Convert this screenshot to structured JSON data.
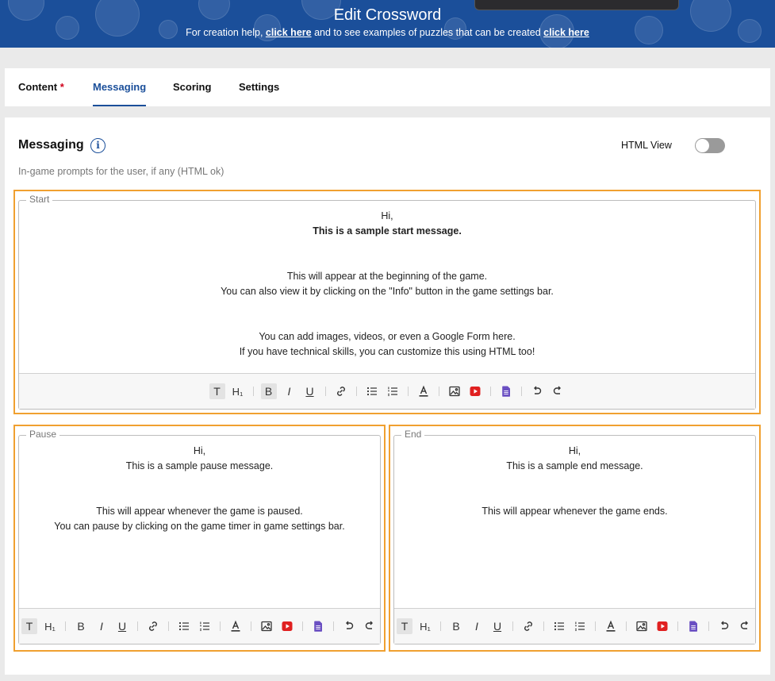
{
  "header": {
    "title": "Edit Crossword",
    "help_prefix": "For creation help, ",
    "help_link1": "click here",
    "help_middle": " and to see examples of puzzles that can be created ",
    "help_link2": "click here"
  },
  "tabs": [
    {
      "label": "Content",
      "required_mark": "*"
    },
    {
      "label": "Messaging"
    },
    {
      "label": "Scoring"
    },
    {
      "label": "Settings"
    }
  ],
  "panel": {
    "title": "Messaging",
    "info_icon_glyph": "i",
    "html_view_label": "HTML View",
    "html_view_enabled": false,
    "subtitle": "In-game prompts for the user, if any (HTML ok)"
  },
  "editors": {
    "start": {
      "legend": "Start",
      "lines": [
        "Hi,",
        "This is a sample start message.",
        "",
        "",
        "This will appear at the beginning of the game.",
        "You can also view it by clicking on the \"Info\" button in the game settings bar.",
        "",
        "",
        "You can add images, videos, or even a Google Form here.",
        "If you have technical skills, you can customize this using HTML too!"
      ]
    },
    "pause": {
      "legend": "Pause",
      "lines": [
        "Hi,",
        "This is a sample pause message.",
        "",
        "",
        "This will appear whenever the game is paused.",
        "You can pause by clicking on the game timer in game settings bar."
      ]
    },
    "end": {
      "legend": "End",
      "lines": [
        "Hi,",
        "This is a sample end message.",
        "",
        "",
        "This will appear whenever the game ends."
      ]
    }
  },
  "toolbar": {
    "text_glyph": "T",
    "heading_glyph": "H₁",
    "bold_glyph": "B",
    "italic_glyph": "I",
    "underline_glyph": "U",
    "icons": [
      "text-format-icon",
      "heading-icon",
      "bold-icon",
      "italic-icon",
      "underline-icon",
      "link-icon",
      "bullet-list-icon",
      "numbered-list-icon",
      "text-color-icon",
      "image-icon",
      "youtube-icon",
      "google-form-icon",
      "undo-icon",
      "redo-icon"
    ]
  },
  "colors": {
    "brand_blue": "#1b4f9a",
    "highlight_orange": "#f0a030",
    "required_red": "#d0021b",
    "youtube_red": "#e02020",
    "form_purple": "#6a4fc2"
  }
}
